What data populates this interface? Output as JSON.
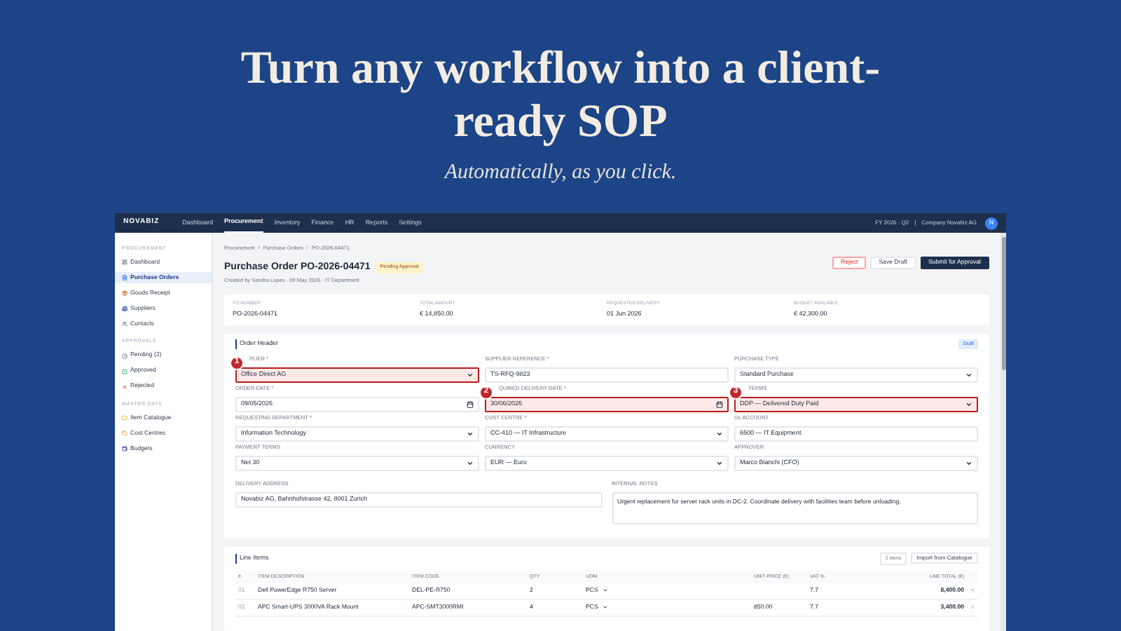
{
  "hero": {
    "title": "Turn any workflow into a client-ready SOP",
    "subtitle": "Automatically, as you click."
  },
  "app": {
    "logo": "NOVABIZ",
    "nav": [
      {
        "label": "Dashboard",
        "selected": false
      },
      {
        "label": "Procurement",
        "selected": true
      },
      {
        "label": "Inventory",
        "selected": false
      },
      {
        "label": "Finance",
        "selected": false
      },
      {
        "label": "HR",
        "selected": false
      },
      {
        "label": "Reports",
        "selected": false
      },
      {
        "label": "Settings",
        "selected": false
      }
    ],
    "period": "FY 2026 · Q2",
    "separator": "|",
    "company": "Company Novabiz AG",
    "avatar": "N",
    "sidebar": [
      {
        "heading": "PROCUREMENT",
        "items": [
          {
            "label": "Dashboard",
            "selected": false
          },
          {
            "label": "Purchase Orders",
            "selected": true
          },
          {
            "label": "Goods Receipt",
            "selected": false
          },
          {
            "label": "Suppliers",
            "selected": false
          },
          {
            "label": "Contacts",
            "selected": false
          }
        ]
      },
      {
        "heading": "APPROVALS",
        "items": [
          {
            "label": "Pending (3)",
            "selected": false
          },
          {
            "label": "Approved",
            "selected": false
          },
          {
            "label": "Rejected",
            "selected": false
          }
        ]
      },
      {
        "heading": "MASTER DATA",
        "items": [
          {
            "label": "Item Catalogue",
            "selected": false
          },
          {
            "label": "Cost Centres",
            "selected": false
          },
          {
            "label": "Budgets",
            "selected": false
          }
        ]
      }
    ],
    "breadcrumb": [
      "Procurement",
      "Purchase Orders",
      "PO-2026-04471"
    ],
    "title": "Purchase Order PO-2026-04471",
    "status": "Pending Approval",
    "subtitle": "Created by Sandra Lopes · 09 May 2026 · IT Department",
    "buttons": [
      {
        "label": "Reject",
        "kind": "danger"
      },
      {
        "label": "Save Draft",
        "kind": "plain"
      },
      {
        "label": "Submit for Approval",
        "kind": "primary"
      }
    ],
    "summary": [
      {
        "label": "PO NUMBER",
        "value": "PO-2026-04471"
      },
      {
        "label": "TOTAL AMOUNT",
        "value": "€ 14,850.00"
      },
      {
        "label": "REQUESTED DELIVERY",
        "value": "01 Jun 2026"
      },
      {
        "label": "BUDGET AVAILABLE",
        "value": "€ 42,300.00"
      }
    ],
    "order_header": {
      "title": "Order Header",
      "badge": "Draft",
      "fields": [
        {
          "label": "PLIER *",
          "value": "Office Direct AG",
          "kind": "select",
          "highlighted": true,
          "marker": "1"
        },
        {
          "label": "SUPPLIER REFERENCE *",
          "value": "TS-RFQ-9823",
          "kind": "input",
          "highlighted": false
        },
        {
          "label": "PURCHASE TYPE",
          "value": "Standard Purchase",
          "kind": "select",
          "highlighted": false
        },
        {
          "label": "ORDER DATE *",
          "value": "09/05/2026",
          "kind": "date",
          "highlighted": false
        },
        {
          "label": "QUIRED DELIVERY DATE *",
          "value": "30/06/2026",
          "kind": "date",
          "highlighted": true,
          "marker": "2"
        },
        {
          "label": "TERMS",
          "value": "DDP — Delivered Duty Paid",
          "kind": "select",
          "highlighted": true,
          "marker": "3"
        },
        {
          "label": "REQUESTING DEPARTMENT *",
          "value": "Information Technology",
          "kind": "select",
          "highlighted": false
        },
        {
          "label": "COST CENTRE *",
          "value": "CC-410 — IT Infrastructure",
          "kind": "select",
          "highlighted": false
        },
        {
          "label": "GL ACCOUNT",
          "value": "6500 — IT Equipment",
          "kind": "input",
          "highlighted": false
        },
        {
          "label": "PAYMENT TERMS",
          "value": "Net 30",
          "kind": "select",
          "highlighted": false
        },
        {
          "label": "CURRENCY",
          "value": "EUR — Euro",
          "kind": "select",
          "highlighted": false
        },
        {
          "label": "APPROVER",
          "value": "Marco Bianchi (CFO)",
          "kind": "select",
          "highlighted": false
        }
      ],
      "delivery_address": {
        "label": "DELIVERY ADDRESS",
        "value": "Novabiz AG, Bahnhofstrasse 42, 8001 Zurich"
      },
      "internal_notes": {
        "label": "INTERNAL NOTES",
        "value": "Urgent replacement for server rack units in DC-2. Coordinate delivery with facilities team before unloading."
      }
    },
    "line_items": {
      "title": "Line Items",
      "count": "2 items",
      "import_button": "Import from Catalogue",
      "columns": [
        "#",
        "ITEM DESCRIPTION",
        "ITEM CODE",
        "QTY",
        "UOM",
        "UNIT PRICE (€)",
        "VAT %",
        "LINE TOTAL (€)"
      ],
      "rows": [
        {
          "number": "01",
          "description": "Dell PowerEdge R750 Server",
          "code": "DEL-PE-R750",
          "qty": "2",
          "uom": "PCS",
          "vat": "7.7",
          "total": "8,400.00"
        },
        {
          "number": "02",
          "description": "APC Smart-UPS 3000VA Rack Mount",
          "code": "APC-SMT3000RMI",
          "qty": "4",
          "uom": "PCS",
          "unit_price": "850.00",
          "vat": "7.7",
          "total": "3,400.00"
        }
      ]
    }
  }
}
